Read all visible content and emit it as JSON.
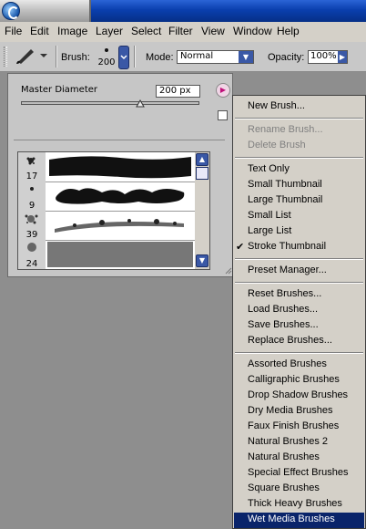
{
  "menubar": {
    "items": [
      "File",
      "Edit",
      "Image",
      "Layer",
      "Select",
      "Filter",
      "View",
      "Window",
      "Help"
    ]
  },
  "options": {
    "brush_label": "Brush:",
    "brush_size": "200",
    "mode_label": "Mode:",
    "mode_value": "Normal",
    "opacity_label": "Opacity:",
    "opacity_value": "100%"
  },
  "palette": {
    "master_diameter_label": "Master Diameter",
    "master_diameter_value": "200 px",
    "slider_level_percent": 67,
    "thumbnails": [
      {
        "size": "17"
      },
      {
        "size": "9"
      },
      {
        "size": "39"
      },
      {
        "size": "24"
      }
    ]
  },
  "flyout_menu": {
    "groups": [
      [
        {
          "label": "New Brush...",
          "enabled": true
        }
      ],
      [
        {
          "label": "Rename Brush...",
          "enabled": false
        },
        {
          "label": "Delete Brush",
          "enabled": false
        }
      ],
      [
        {
          "label": "Text Only",
          "enabled": true
        },
        {
          "label": "Small Thumbnail",
          "enabled": true
        },
        {
          "label": "Large Thumbnail",
          "enabled": true
        },
        {
          "label": "Small List",
          "enabled": true
        },
        {
          "label": "Large List",
          "enabled": true
        },
        {
          "label": "Stroke Thumbnail",
          "enabled": true,
          "checked": true
        }
      ],
      [
        {
          "label": "Preset Manager...",
          "enabled": true
        }
      ],
      [
        {
          "label": "Reset Brushes...",
          "enabled": true
        },
        {
          "label": "Load Brushes...",
          "enabled": true
        },
        {
          "label": "Save Brushes...",
          "enabled": true
        },
        {
          "label": "Replace Brushes...",
          "enabled": true
        }
      ],
      [
        {
          "label": "Assorted Brushes",
          "enabled": true
        },
        {
          "label": "Calligraphic Brushes",
          "enabled": true
        },
        {
          "label": "Drop Shadow Brushes",
          "enabled": true
        },
        {
          "label": "Dry Media Brushes",
          "enabled": true
        },
        {
          "label": "Faux Finish Brushes",
          "enabled": true
        },
        {
          "label": "Natural Brushes 2",
          "enabled": true
        },
        {
          "label": "Natural Brushes",
          "enabled": true
        },
        {
          "label": "Special Effect Brushes",
          "enabled": true
        },
        {
          "label": "Square Brushes",
          "enabled": true
        },
        {
          "label": "Thick Heavy Brushes",
          "enabled": true
        },
        {
          "label": "Wet Media Brushes",
          "enabled": true,
          "highlighted": true
        }
      ]
    ]
  },
  "colors": {
    "accent": "#0a246a",
    "titlebar": "#0a3fae"
  }
}
